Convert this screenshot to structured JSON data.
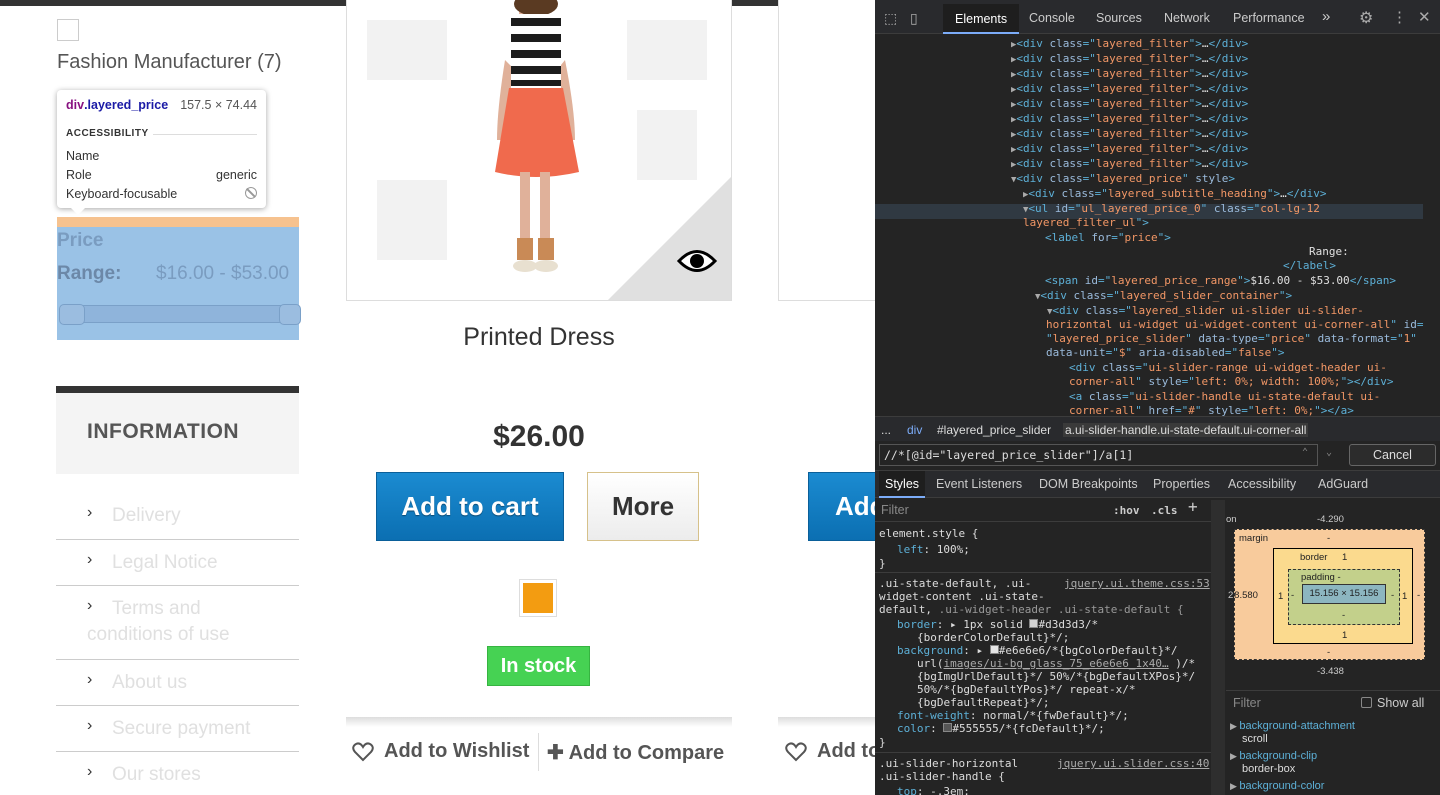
{
  "page": {
    "manufacturer_filter": "Fashion Manufacturer (7)",
    "price_heading": "Price",
    "range_label": "Range:",
    "range_value": "$16.00 - $53.00",
    "info_title": "INFORMATION",
    "info_items": [
      "Delivery",
      "Legal Notice",
      "Terms and",
      "conditions of use",
      "About us",
      "Secure payment",
      "Our stores"
    ],
    "product": {
      "name": "Printed Dress",
      "price": "$26.00",
      "add_to_cart": "Add to cart",
      "more": "More",
      "stock": "In stock",
      "wishlist": "Add to Wishlist",
      "compare": "Add to Compare",
      "swatch_color": "#f39c11"
    },
    "product2": {
      "add_to_cart_partial": "Add",
      "wishlist_partial": "Add to"
    }
  },
  "tooltip": {
    "selector_tag": "div",
    "selector_class": ".layered_price",
    "size": "157.5 × 74.44",
    "accessibility": "ACCESSIBILITY",
    "name_label": "Name",
    "role_label": "Role",
    "role_value": "generic",
    "keyboard_label": "Keyboard-focusable"
  },
  "devtools": {
    "tabs": [
      "Elements",
      "Console",
      "Sources",
      "Network",
      "Performance"
    ],
    "more_tabs": "»",
    "breadcrumb": [
      "...",
      "div",
      "#layered_price_slider",
      "a.ui-slider-handle.ui-state-default.ui-corner-all"
    ],
    "search_value": "//*[@id=\"layered_price_slider\"]/a[1]",
    "cancel": "Cancel",
    "style_tabs": [
      "Styles",
      "Event Listeners",
      "DOM Breakpoints",
      "Properties",
      "Accessibility",
      "AdGuard"
    ],
    "filter_placeholder": "Filter",
    "hov": ":hov",
    "cls": ".cls",
    "box_model": {
      "position_label": "on",
      "margin_label": "margin",
      "margin_top": "-4.290",
      "margin_bottom": "-3.438",
      "margin_left": "-8.580",
      "margin_right": "-",
      "border_label": "border",
      "border_value": "1",
      "padding_label": "padding -",
      "content": "15.156 × 15.156",
      "dash": "-",
      "left_edge": "2"
    },
    "computed_filter": "Filter",
    "show_all": "Show all",
    "computed": [
      {
        "prop": "background-attachment",
        "value": "scroll"
      },
      {
        "prop": "background-clip",
        "value": "border-box"
      },
      {
        "prop": "background-color",
        "value": ""
      }
    ]
  }
}
